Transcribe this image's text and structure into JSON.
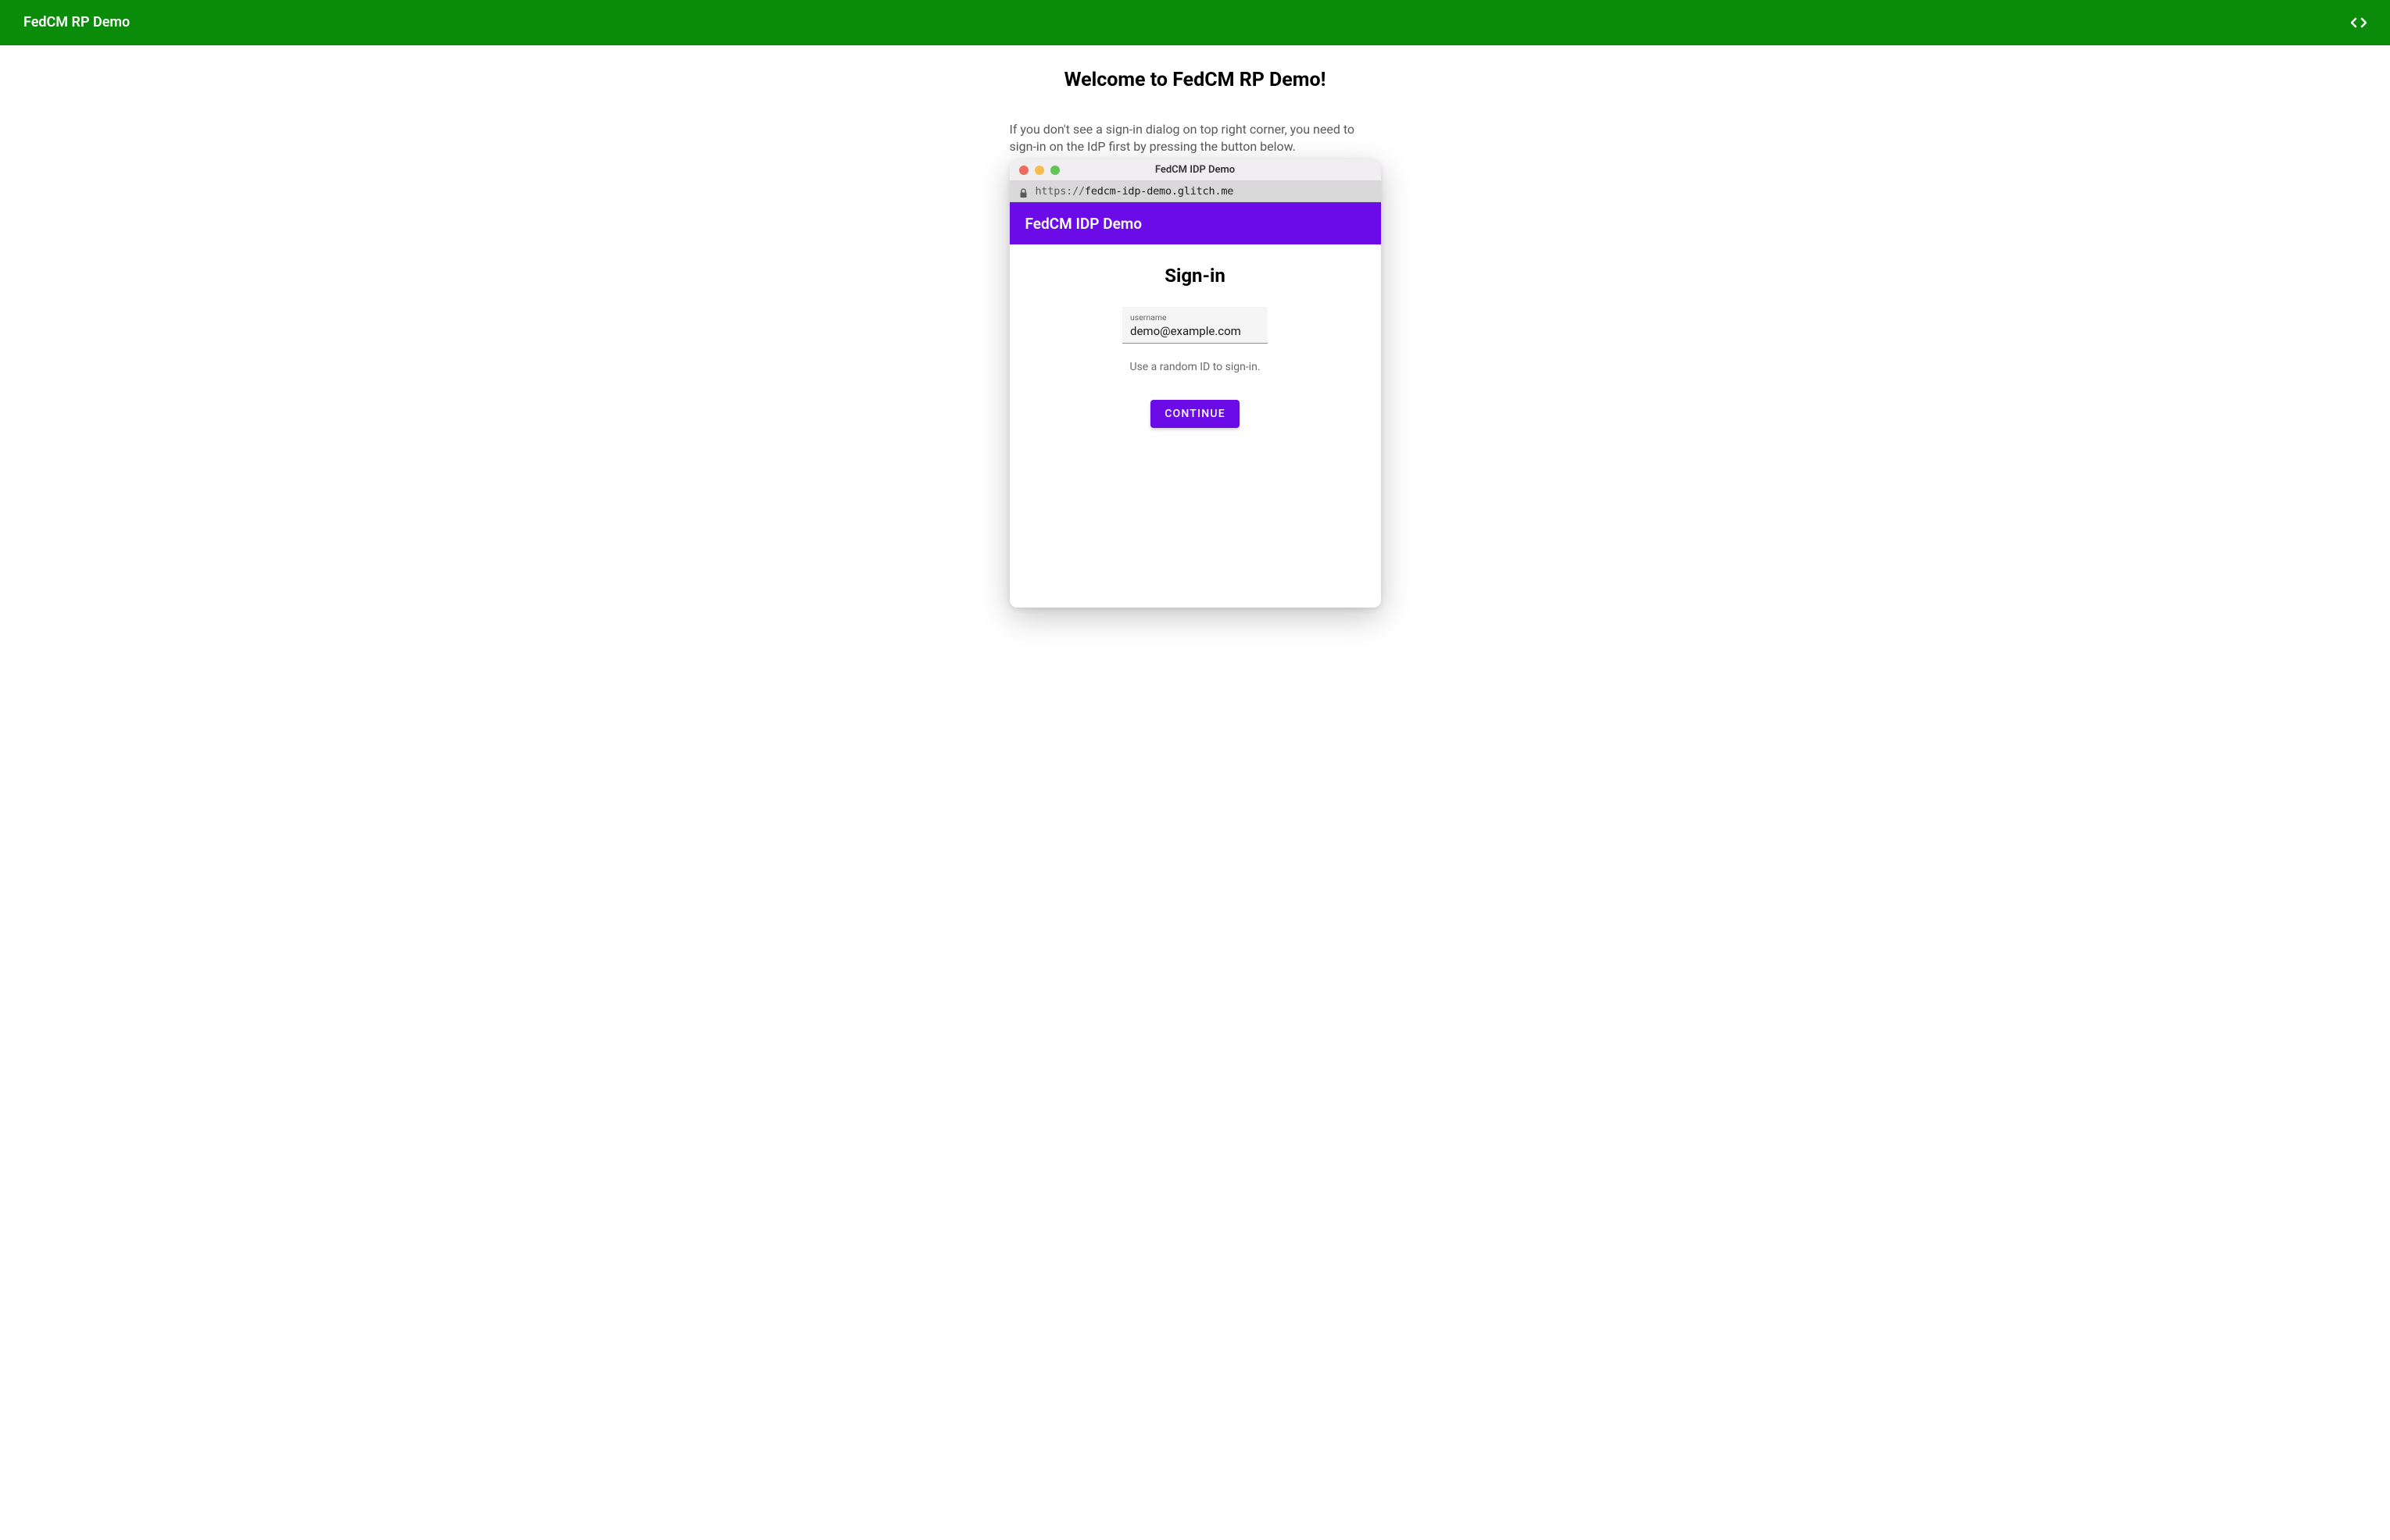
{
  "topBar": {
    "title": "FedCM RP Demo"
  },
  "main": {
    "heading": "Welcome to FedCM RP Demo!",
    "instruction": "If you don't see a sign-in dialog on top right corner, you need to sign-in on the IdP first by pressing the button below."
  },
  "browserWindow": {
    "title": "FedCM IDP Demo",
    "url": {
      "protocol": "https://",
      "domain": "fedcm-idp-demo.glitch.me"
    },
    "idp": {
      "headerTitle": "FedCM IDP Demo",
      "signinHeading": "Sign-in",
      "input": {
        "label": "username",
        "value": "demo@example.com"
      },
      "hint": "Use a random ID to sign-in.",
      "continueLabel": "CONTINUE"
    }
  }
}
